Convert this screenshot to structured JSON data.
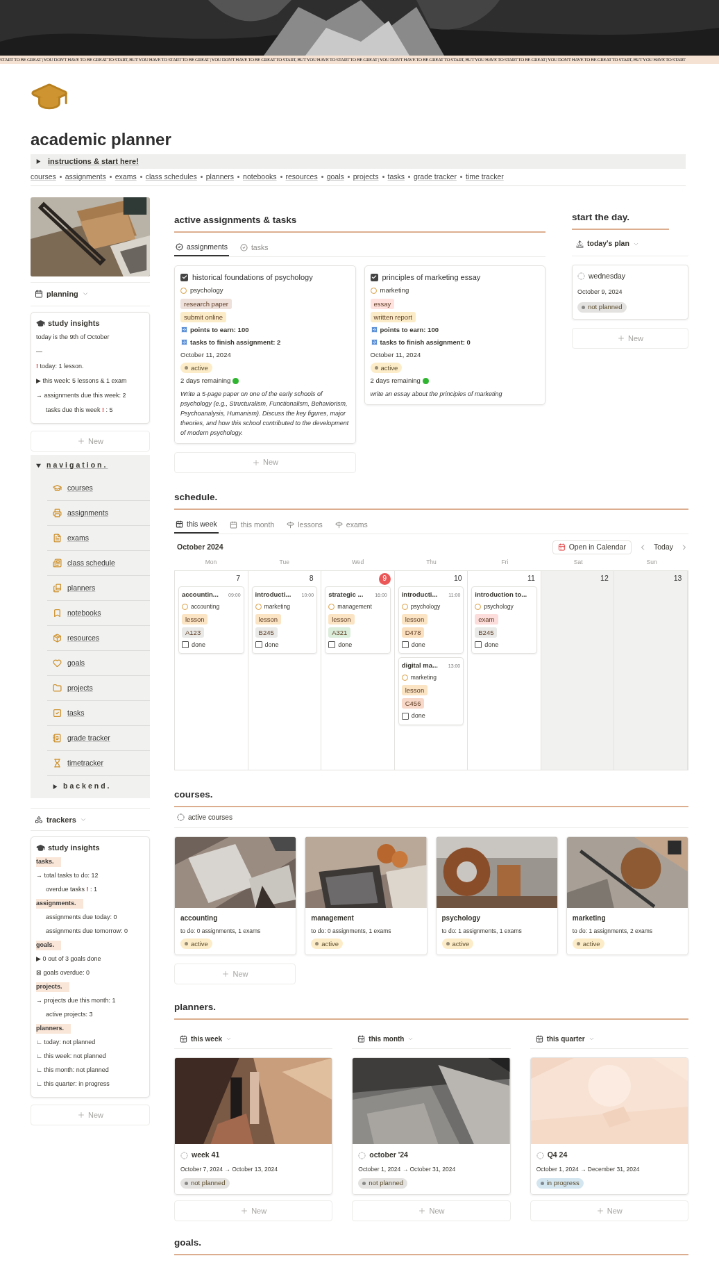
{
  "banner_strip": "START TO BE GREAT | YOU DON'T HAVE TO BE GREAT TO START, BUT YOU HAVE TO START TO BE GREAT | YOU DON'T HAVE TO BE GREAT TO START, BUT YOU HAVE TO START TO BE GREAT | YOU DON'T HAVE TO BE GREAT TO START, BUT YOU HAVE TO START TO BE GREAT | YOU DON'T HAVE TO BE GREAT TO START, BUT YOU HAVE TO START",
  "page": {
    "title": "academic planner"
  },
  "toggle": {
    "label": "instructions & start here!",
    "expanded": false
  },
  "quick_links": [
    "courses",
    "assignments",
    "exams",
    "class schedules",
    "planners",
    "notebooks",
    "resources",
    "goals",
    "projects",
    "tasks",
    "grade tracker",
    "time tracker"
  ],
  "sidebar": {
    "planning_view": "planning",
    "planning_insights": {
      "title": "study insights",
      "lines": [
        {
          "kind": "plain",
          "parts": [
            {
              "text": "today is the 9th of October",
              "alert": false
            }
          ]
        },
        {
          "kind": "plain",
          "parts": [
            {
              "text": "—",
              "alert": false
            }
          ]
        },
        {
          "kind": "plain",
          "parts": [
            {
              "text": "!",
              "alert": true
            },
            {
              "text": " today: 1 lesson.",
              "alert": false
            }
          ]
        },
        {
          "kind": "plain",
          "parts": [
            {
              "text": "▶ this week: 5 lessons & 1 exam",
              "alert": false
            }
          ]
        },
        {
          "kind": "plain",
          "parts": [
            {
              "text": "→ assignments due this week: 2",
              "alert": false
            }
          ]
        },
        {
          "kind": "sub",
          "parts": [
            {
              "text": "tasks due this week ",
              "alert": false
            },
            {
              "text": "!",
              "alert": true
            },
            {
              "text": " : 5",
              "alert": false
            }
          ]
        }
      ]
    },
    "planning_new": "New",
    "navigation": {
      "label": "navigation.",
      "expanded": true,
      "items": [
        "courses",
        "assignments",
        "exams",
        "class schedule",
        "planners",
        "notebooks",
        "resources",
        "goals",
        "projects",
        "tasks",
        "grade tracker",
        "timetracker"
      ]
    },
    "backend": {
      "label": "backend.",
      "expanded": false
    },
    "trackers_view": "trackers",
    "tracker_insights": {
      "title": "study insights",
      "lines": [
        {
          "kind": "heading",
          "parts": [
            {
              "text": "tasks.",
              "alert": false
            }
          ]
        },
        {
          "kind": "plain",
          "parts": [
            {
              "text": "→ total tasks to do: 12",
              "alert": false
            }
          ]
        },
        {
          "kind": "sub",
          "parts": [
            {
              "text": "overdue tasks ",
              "alert": false
            },
            {
              "text": "!",
              "alert": true
            },
            {
              "text": " : 1",
              "alert": false
            }
          ]
        },
        {
          "kind": "heading",
          "parts": [
            {
              "text": "assignments.",
              "alert": false
            }
          ]
        },
        {
          "kind": "sub",
          "parts": [
            {
              "text": "assignments due today: 0",
              "alert": false
            }
          ]
        },
        {
          "kind": "sub",
          "parts": [
            {
              "text": "assignments due tomorrow: 0",
              "alert": false
            }
          ]
        },
        {
          "kind": "heading",
          "parts": [
            {
              "text": "goals.",
              "alert": false
            }
          ]
        },
        {
          "kind": "plain",
          "parts": [
            {
              "text": "▶ 0 out of 3 goals done",
              "alert": false
            }
          ]
        },
        {
          "kind": "plain",
          "parts": [
            {
              "text": "⊠ goals overdue: 0",
              "alert": false
            }
          ]
        },
        {
          "kind": "heading",
          "parts": [
            {
              "text": "projects.",
              "alert": false
            }
          ]
        },
        {
          "kind": "plain",
          "parts": [
            {
              "text": "→ projects due this month: 1",
              "alert": false
            }
          ]
        },
        {
          "kind": "sub",
          "parts": [
            {
              "text": "active projects: 3",
              "alert": false
            }
          ]
        },
        {
          "kind": "heading",
          "parts": [
            {
              "text": "planners.",
              "alert": false
            }
          ]
        },
        {
          "kind": "plain",
          "parts": [
            {
              "text": "∟ today: not planned",
              "alert": false
            }
          ]
        },
        {
          "kind": "plain",
          "parts": [
            {
              "text": "∟ this week: not planned",
              "alert": false
            }
          ]
        },
        {
          "kind": "plain",
          "parts": [
            {
              "text": "∟ this month: not planned",
              "alert": false
            }
          ]
        },
        {
          "kind": "plain",
          "parts": [
            {
              "text": "∟ this quarter: in progress",
              "alert": false
            }
          ]
        }
      ]
    },
    "trackers_new": "New"
  },
  "assignments": {
    "heading": "active assignments & tasks",
    "tabs": [
      {
        "label": "assignments",
        "selected": true
      },
      {
        "label": "tasks",
        "selected": false
      }
    ],
    "cards": [
      {
        "title": "historical foundations of psychology",
        "checked": true,
        "course": "psychology",
        "tags": [
          {
            "text": "research paper",
            "color": "#eee0da"
          },
          {
            "text": "submit online",
            "color": "#fbecc7"
          }
        ],
        "points": "points to earn: 100",
        "tasks": "tasks to finish assignment: 2",
        "date": "October 11, 2024",
        "status": {
          "text": "active",
          "color": "#fdecc8"
        },
        "remaining": "2 days remaining",
        "description": "Write a 5-page paper on one of the early schools of psychology (e.g., Structuralism, Functionalism, Behaviorism, Psychoanalysis, Humanism). Discuss the key figures, major theories, and how this school contributed to the development of modern psychology."
      },
      {
        "title": "principles of marketing essay",
        "checked": true,
        "course": "marketing",
        "tags": [
          {
            "text": "essay",
            "color": "#ffe2dd"
          },
          {
            "text": "written report",
            "color": "#fbecc7"
          }
        ],
        "points": "points to earn: 100",
        "tasks": "tasks to finish assignment: 0",
        "date": "October 11, 2024",
        "status": {
          "text": "active",
          "color": "#fdecc8"
        },
        "remaining": "2 days remaining",
        "description": "write an essay about the principles of marketing"
      }
    ],
    "new": "New"
  },
  "start_the_day": {
    "heading": "start the day.",
    "view": "today's plan",
    "card": {
      "title": "wednesday",
      "date": "October 9, 2024",
      "status": {
        "text": "not planned",
        "color": "#e3e2e0"
      }
    },
    "new": "New"
  },
  "schedule": {
    "heading": "schedule.",
    "tabs": [
      {
        "label": "this week",
        "selected": true
      },
      {
        "label": "this month",
        "selected": false
      },
      {
        "label": "lessons",
        "selected": false
      },
      {
        "label": "exams",
        "selected": false
      }
    ],
    "month": "October 2024",
    "open_button": "Open in Calendar",
    "today_button": "Today",
    "weekdays": [
      "Mon",
      "Tue",
      "Wed",
      "Thu",
      "Fri",
      "Sat",
      "Sun"
    ],
    "days": [
      {
        "number": "7",
        "today": false,
        "weekend": false,
        "events": [
          {
            "title": "accountin...",
            "time": "09:00",
            "course": "accounting",
            "type": {
              "text": "lesson",
              "color": "#fbe4c4"
            },
            "room": {
              "text": "A123",
              "color": "#e9e9e7"
            },
            "done": false,
            "done_label": "done"
          }
        ]
      },
      {
        "number": "8",
        "today": false,
        "weekend": false,
        "events": [
          {
            "title": "introducti...",
            "time": "10:00",
            "course": "marketing",
            "type": {
              "text": "lesson",
              "color": "#fbe4c4"
            },
            "room": {
              "text": "B245",
              "color": "#e9e9e7"
            },
            "done": false,
            "done_label": "done"
          }
        ]
      },
      {
        "number": "9",
        "today": true,
        "weekend": false,
        "events": [
          {
            "title": "strategic ...",
            "time": "16:00",
            "course": "management",
            "type": {
              "text": "lesson",
              "color": "#fbe4c4"
            },
            "room": {
              "text": "A321",
              "color": "#dbeddb"
            },
            "done": false,
            "done_label": "done"
          }
        ]
      },
      {
        "number": "10",
        "today": false,
        "weekend": false,
        "events": [
          {
            "title": "introducti...",
            "time": "11:00",
            "course": "psychology",
            "type": {
              "text": "lesson",
              "color": "#fbe4c4"
            },
            "room": {
              "text": "D478",
              "color": "#fbe0c0"
            },
            "done": false,
            "done_label": "done"
          },
          {
            "title": "digital ma...",
            "time": "13:00",
            "course": "marketing",
            "type": {
              "text": "lesson",
              "color": "#fbe4c4"
            },
            "room": {
              "text": "C456",
              "color": "#f8d8c8"
            },
            "done": false,
            "done_label": "done"
          }
        ]
      },
      {
        "number": "11",
        "today": false,
        "weekend": false,
        "events": [
          {
            "title": "introduction to...",
            "course": "psychology",
            "type": {
              "text": "exam",
              "color": "#fddcdc"
            },
            "room": {
              "text": "B245",
              "color": "#e9e9e7"
            },
            "done": false,
            "done_label": "done"
          }
        ]
      },
      {
        "number": "12",
        "today": false,
        "weekend": true
      },
      {
        "number": "13",
        "today": false,
        "weekend": true
      }
    ]
  },
  "courses": {
    "heading": "courses.",
    "view": "active courses",
    "cards": [
      {
        "name": "accounting",
        "todo": "to do: 0 assignments, 1 exams",
        "status": {
          "text": "active",
          "color": "#fdecc8"
        }
      },
      {
        "name": "management",
        "todo": "to do: 0 assignments, 1 exams",
        "status": {
          "text": "active",
          "color": "#fdecc8"
        }
      },
      {
        "name": "psychology",
        "todo": "to do: 1 assignments, 1 exams",
        "status": {
          "text": "active",
          "color": "#fdecc8"
        }
      },
      {
        "name": "marketing",
        "todo": "to do: 1 assignments, 2 exams",
        "status": {
          "text": "active",
          "color": "#fdecc8"
        }
      }
    ],
    "new": "New"
  },
  "planners": {
    "heading": "planners.",
    "columns": [
      {
        "view": "this week",
        "card": {
          "title": "week 41",
          "dates": "October 7, 2024 → October 13, 2024",
          "status": {
            "text": "not planned",
            "color": "#e3e2e0"
          }
        },
        "new": "New"
      },
      {
        "view": "this month",
        "card": {
          "title": "october '24",
          "dates": "October 1, 2024 → October 31, 2024",
          "status": {
            "text": "not planned",
            "color": "#e3e2e0"
          }
        },
        "new": "New"
      },
      {
        "view": "this quarter",
        "card": {
          "title": "Q4 24",
          "dates": "October 1, 2024 → December 31, 2024",
          "status": {
            "text": "in progress",
            "color": "#d3e5ef"
          }
        },
        "new": "New"
      }
    ]
  },
  "goals": {
    "heading": "goals."
  }
}
